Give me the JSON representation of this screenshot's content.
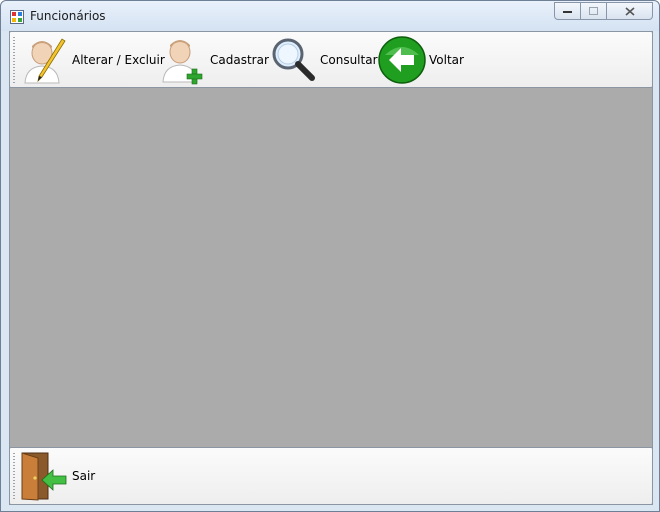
{
  "window": {
    "title": "Funcionários"
  },
  "toolbar": {
    "items": [
      {
        "label": "Alterar / Excluir",
        "icon": "user-edit-icon"
      },
      {
        "label": "Cadastrar",
        "icon": "user-add-icon"
      },
      {
        "label": "Consultar",
        "icon": "search-icon"
      },
      {
        "label": "Voltar",
        "icon": "back-arrow-icon"
      }
    ]
  },
  "bottombar": {
    "exit": {
      "label": "Sair",
      "icon": "exit-door-icon"
    }
  },
  "colors": {
    "client_background": "#ababab",
    "back_button_green": "#1f9e1f",
    "add_green": "#2ea52e"
  }
}
